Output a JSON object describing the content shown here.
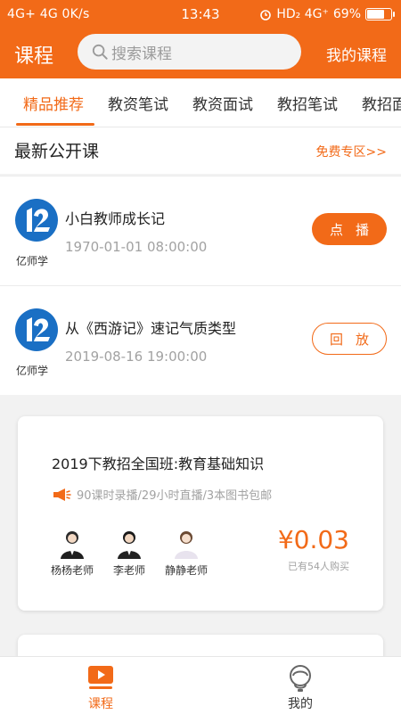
{
  "colors": {
    "accent": "#f26a18",
    "muted": "#a2a2a2"
  },
  "status_bar": {
    "network": "4G+ 4G 0K/s",
    "time": "13:43",
    "indicators": "HD₂ 4G⁺",
    "battery_text": "69%",
    "battery_level": 0.69
  },
  "header": {
    "title": "课程",
    "search_placeholder": "搜索课程",
    "my_courses": "我的课程"
  },
  "tabs": [
    {
      "label": "精品推荐",
      "active": true
    },
    {
      "label": "教资笔试",
      "active": false
    },
    {
      "label": "教资面试",
      "active": false
    },
    {
      "label": "教招笔试",
      "active": false
    },
    {
      "label": "教招面",
      "active": false
    }
  ],
  "public_section": {
    "title": "最新公开课",
    "more": "免费专区>>"
  },
  "courses": [
    {
      "logo_label": "亿师学",
      "title": "小白教师成长记",
      "time": "1970-01-01 08:00:00",
      "button": "点播"
    },
    {
      "logo_label": "亿师学",
      "title": "从《西游记》速记气质类型",
      "time": "2019-08-16 19:00:00",
      "button": "回放"
    }
  ],
  "class_card": {
    "title": "2019下教招全国班:教育基础知识",
    "meta": "90课时录播/29小时直播/3本图书包邮",
    "teachers": [
      {
        "name": "杨杨老师"
      },
      {
        "name": "李老师"
      },
      {
        "name": "静静老师"
      }
    ],
    "price": "¥0.03",
    "buyers": "已有54人购买"
  },
  "bottom_nav": [
    {
      "label": "课程",
      "icon": "play-icon",
      "active": true
    },
    {
      "label": "我的",
      "icon": "profile-icon",
      "active": false
    }
  ]
}
